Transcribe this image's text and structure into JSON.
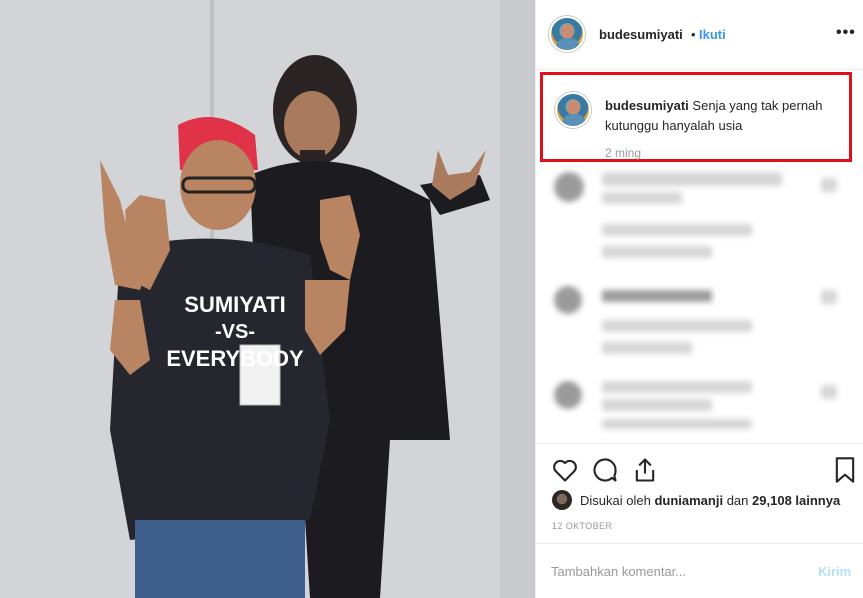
{
  "post": {
    "username": "budesumiyati",
    "dot": "•",
    "follow_label": "Ikuti",
    "more_icon": "more-options-icon",
    "caption": {
      "username": "budesumiyati",
      "text": "Senja yang tak pernah kutunggu hanyalah usia",
      "time": "2 ming"
    },
    "photo": {
      "shirt_text_line1": "SUMIYATI",
      "shirt_text_line2": "-VS-",
      "shirt_text_line3": "EVERYBODY"
    },
    "actions": {
      "like_icon": "heart-icon",
      "comment_icon": "comment-icon",
      "share_icon": "share-icon",
      "save_icon": "bookmark-icon"
    },
    "likes": {
      "prefix": "Disukai oleh",
      "user": "duniamanji",
      "conj": "dan",
      "count": "29,108 lainnya"
    },
    "date": "12 OKTOBER",
    "comment_placeholder": "Tambahkan komentar...",
    "post_label": "Kirim",
    "colors": {
      "accent": "#3897f0",
      "highlight_border": "#e0101a",
      "post_disabled": "#b2dffc"
    }
  }
}
